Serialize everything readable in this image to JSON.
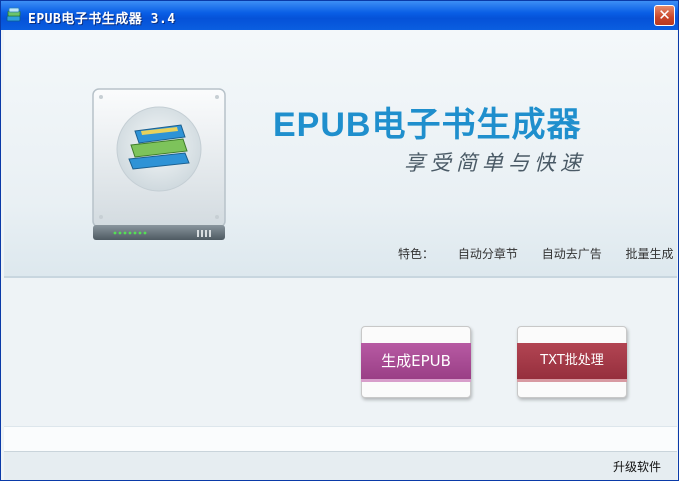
{
  "window": {
    "title": "EPUB电子书生成器 3.4",
    "close_glyph": "✕"
  },
  "hero": {
    "brand": "EPUB电子书生成器",
    "slogan": "享受简单与快速",
    "features": {
      "label": "特色：",
      "items": [
        "自动分章节",
        "自动去广告",
        "批量生成"
      ]
    }
  },
  "actions": {
    "generate_epub": "生成EPUB",
    "txt_batch": "TXT批处理"
  },
  "status": {
    "upgrade_link": "升级软件"
  },
  "icons": {
    "app": "book-stack-icon",
    "device": "book-device-icon",
    "close": "close-icon"
  },
  "colors": {
    "titlebar": "#0a5fe6",
    "brand": "#1f8fcd",
    "epub_button": "#9a3f86",
    "txt_button": "#962f3d"
  }
}
